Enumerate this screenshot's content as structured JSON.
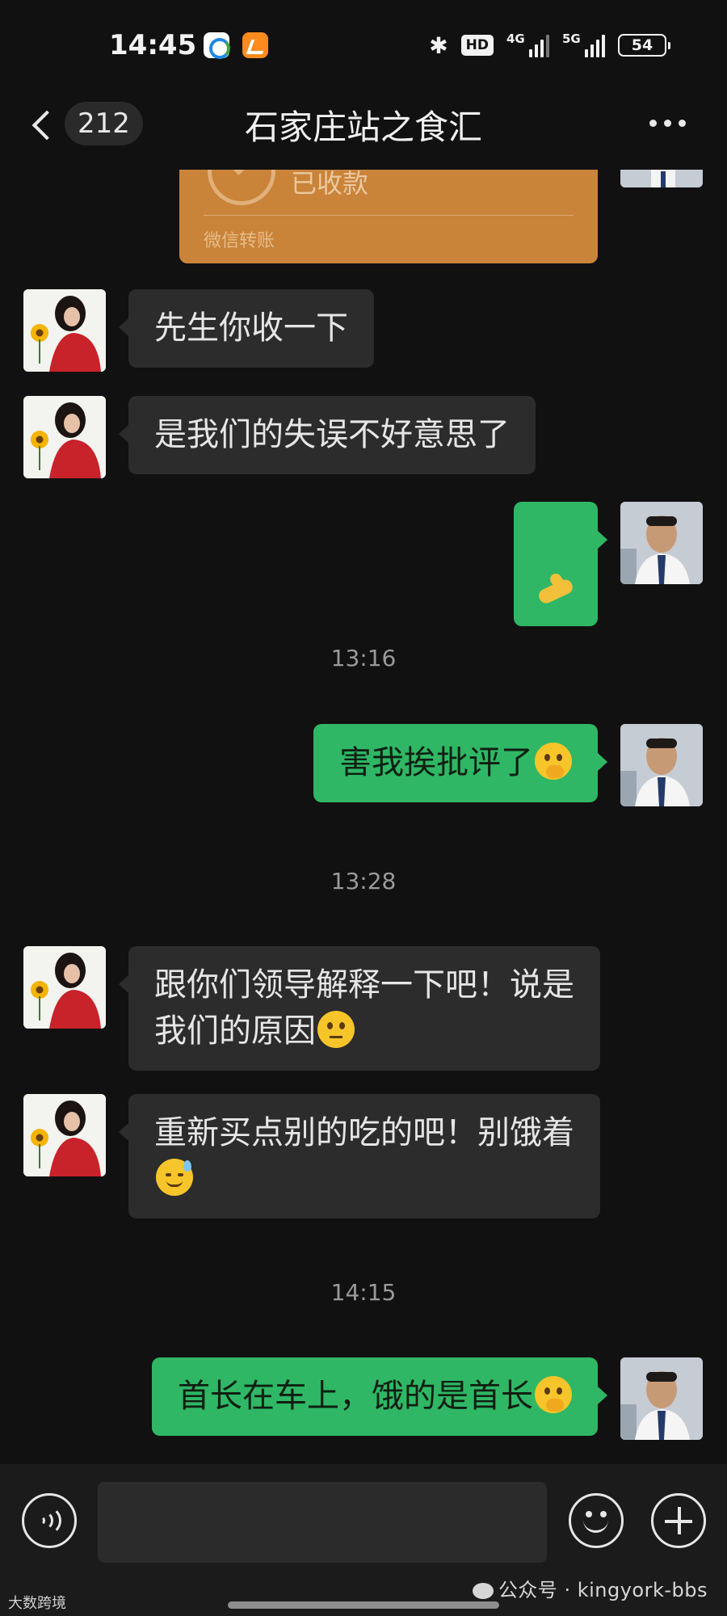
{
  "status_bar": {
    "time": "14:45",
    "hd_label": "HD",
    "network_1": "4G",
    "network_2": "5G",
    "battery": "54"
  },
  "header": {
    "unread_count": "212",
    "title": "石家庄站之食汇"
  },
  "transfer": {
    "status": "已收款",
    "footer": "微信转账"
  },
  "messages": {
    "m1": "先生你收一下",
    "m2": "是我们的失误不好意思了",
    "t1": "13:16",
    "m4": "害我挨批评了",
    "t2": "13:28",
    "m5": "跟你们领导解释一下吧！说是\n我们的原因",
    "m6": "重新买点别的吃的吧！别饿着\n",
    "t3": "14:15",
    "m7": "首长在车上，饿的是首长"
  },
  "input": {
    "placeholder": ""
  },
  "watermark": {
    "left": "大数跨境",
    "right": "公众号 · kingyork-bbs"
  },
  "icons": {
    "back": "chevron-left-icon",
    "more": "more-dots-icon",
    "voice": "voice-icon",
    "emoji": "emoji-icon",
    "plus": "plus-icon"
  },
  "colors": {
    "background": "#111111",
    "bubble_incoming": "#2c2c2c",
    "bubble_outgoing": "#2fb765",
    "transfer_card": "#c9843a"
  }
}
